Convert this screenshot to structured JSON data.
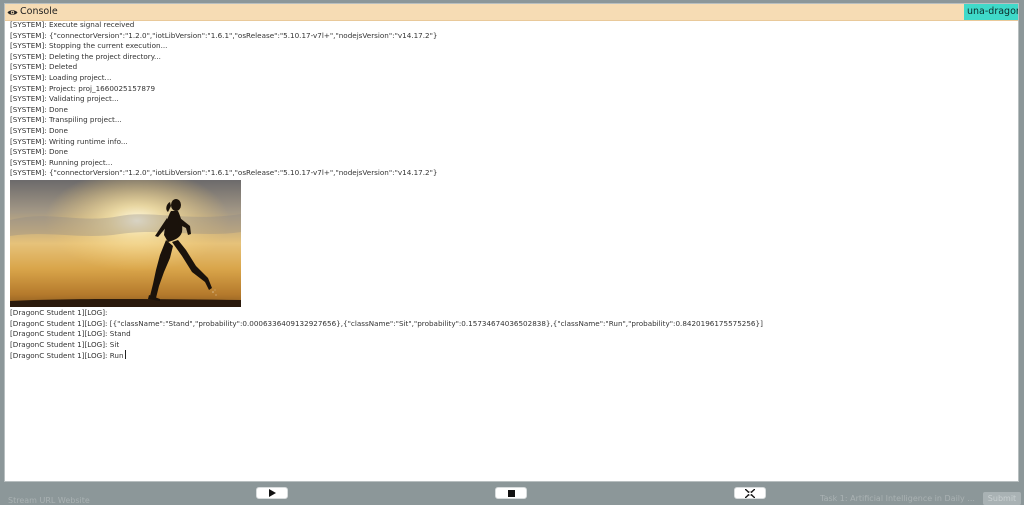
{
  "console": {
    "title": "Console",
    "device": "una-dragon-pi",
    "system_logs": [
      "[SYSTEM]: Execute signal received",
      "[SYSTEM]: {\"connectorVersion\":\"1.2.0\",\"iotLibVersion\":\"1.6.1\",\"osRelease\":\"5.10.17-v7l+\",\"nodejsVersion\":\"v14.17.2\"}",
      "[SYSTEM]: Stopping the current execution...",
      "[SYSTEM]: Deleting the project directory...",
      "[SYSTEM]: Deleted",
      "[SYSTEM]: Loading project...",
      "[SYSTEM]: Project: proj_1660025157879",
      "[SYSTEM]: Validating project...",
      "[SYSTEM]: Done",
      "[SYSTEM]: Transpiling project...",
      "[SYSTEM]: Done",
      "[SYSTEM]: Writing runtime info...",
      "[SYSTEM]: Done",
      "[SYSTEM]: Running project...",
      "[SYSTEM]: {\"connectorVersion\":\"1.2.0\",\"iotLibVersion\":\"1.6.1\",\"osRelease\":\"5.10.17-v7l+\",\"nodejsVersion\":\"v14.17.2\"}"
    ],
    "student_logs": [
      "[DragonC Student 1][LOG]:",
      "[DragonC Student 1][LOG]: [{\"className\":\"Stand\",\"probability\":0.0006336409132927656},{\"className\":\"Sit\",\"probability\":0.15734674036502838},{\"className\":\"Run\",\"probability\":0.8420196175575256}]",
      "[DragonC Student 1][LOG]: Stand",
      "[DragonC Student 1][LOG]: Sit"
    ],
    "last_log": "[DragonC Student 1][LOG]: Run"
  },
  "controls": {
    "play": "play-icon",
    "stop": "stop-icon",
    "fullscreen": "collapse-icon"
  },
  "background": {
    "left_text": "Stream URL   Website",
    "right_text": "Task 1: Artificial Intelligence in Daily ...",
    "button": "Submit"
  },
  "colors": {
    "header": "#f6dcb4",
    "device_badge": "#3fd9c9",
    "backdrop": "#8c9799"
  }
}
